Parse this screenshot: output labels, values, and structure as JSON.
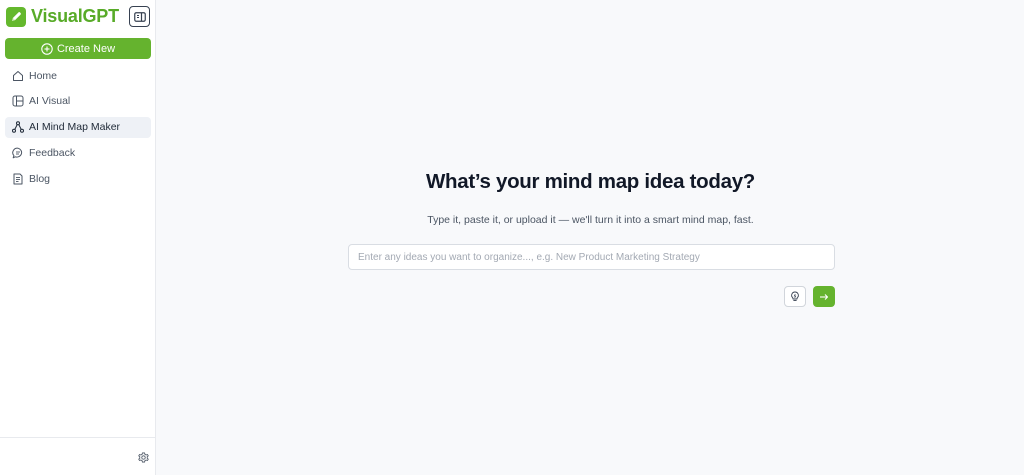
{
  "app": {
    "brand_name": "VisualGPT",
    "accent_color": "#65b32e"
  },
  "sidebar": {
    "create_label": "Create New",
    "items": [
      {
        "label": "Home",
        "icon": "home-icon",
        "active": false
      },
      {
        "label": "AI Visual",
        "icon": "layout-icon",
        "active": false
      },
      {
        "label": "AI Mind Map Maker",
        "icon": "mind-map-icon",
        "active": true
      },
      {
        "label": "Feedback",
        "icon": "chat-bubble-icon",
        "active": false
      },
      {
        "label": "Blog",
        "icon": "document-icon",
        "active": false
      }
    ]
  },
  "main": {
    "title": "What’s your mind map idea today?",
    "subtitle": "Type it, paste it, or upload it — we'll turn it into a smart mind map, fast.",
    "input": {
      "value": "",
      "placeholder": "Enter any ideas you want to organize..., e.g. New Product Marketing Strategy"
    }
  }
}
